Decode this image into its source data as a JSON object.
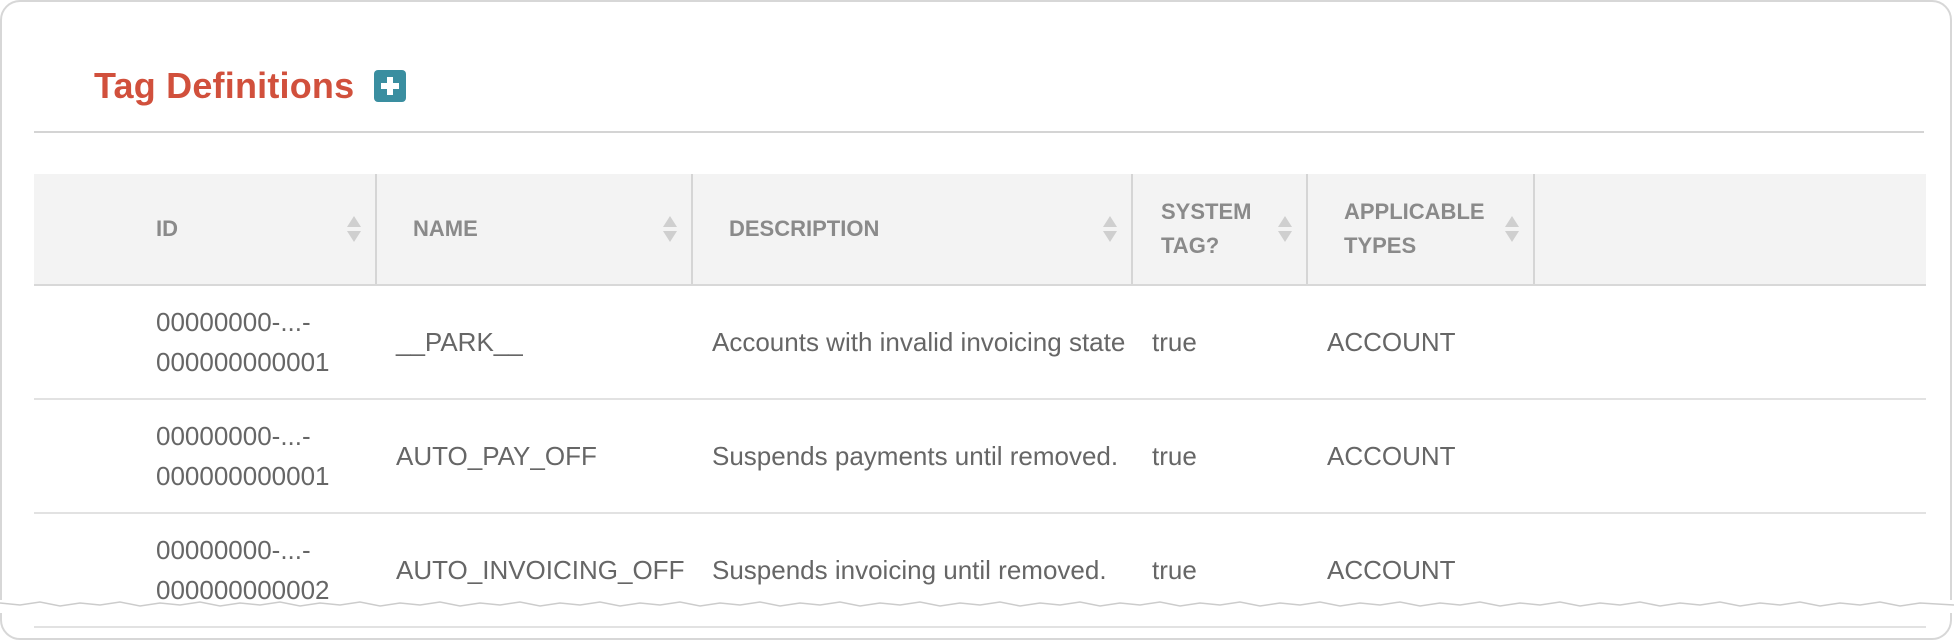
{
  "page": {
    "title": "Tag Definitions",
    "add_icon": "plus-square-icon"
  },
  "colors": {
    "title": "#d1503c",
    "add_button": "#3a8ea0",
    "header_bg": "#f3f3f3",
    "text": "#666666",
    "header_text": "#8a8a8a"
  },
  "table": {
    "columns": [
      {
        "key": "id",
        "label": "ID"
      },
      {
        "key": "name",
        "label": "NAME"
      },
      {
        "key": "description",
        "label": "DESCRIPTION"
      },
      {
        "key": "system_tag",
        "label": "SYSTEM TAG?"
      },
      {
        "key": "applicable_types",
        "label": "APPLICABLE TYPES"
      }
    ],
    "rows": [
      {
        "id_line1": "00000000-...-",
        "id_line2": "000000000001",
        "name": "__PARK__",
        "description": "Accounts with invalid invoicing state",
        "system_tag": "true",
        "applicable_types": "ACCOUNT"
      },
      {
        "id_line1": "00000000-...-",
        "id_line2": "000000000001",
        "name": "AUTO_PAY_OFF",
        "description": "Suspends payments until removed.",
        "system_tag": "true",
        "applicable_types": "ACCOUNT"
      },
      {
        "id_line1": "00000000-...-",
        "id_line2": "000000000002",
        "name": "AUTO_INVOICING_OFF",
        "description": "Suspends invoicing until removed.",
        "system_tag": "true",
        "applicable_types": "ACCOUNT"
      }
    ]
  }
}
